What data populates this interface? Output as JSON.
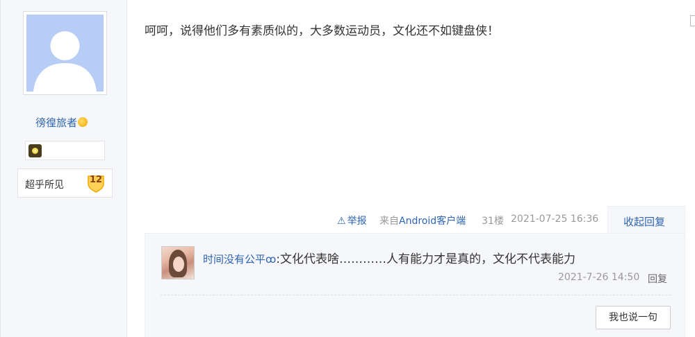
{
  "author": {
    "name": "徬徨旅者",
    "name_emoji": "laughing-emoji",
    "badge_icon": "medal-icon",
    "level_title": "超乎所见",
    "level_number": "12"
  },
  "post": {
    "content": "呵呵，说得他们多有素质似的，大多数运动员，文化还不如键盘侠！"
  },
  "meta": {
    "report_icon": "⚠",
    "report_label": "举报",
    "source_prefix": "来自",
    "source_name": "Android客户端",
    "floor": "31楼",
    "time": "2021-07-25 16:36",
    "collapse_label": "收起回复"
  },
  "reply": {
    "user": "时间没有公平",
    "user_suffix": "ꝏ",
    "separator": ":",
    "content": "文化代表啥…………人有能力才是真的，文化不代表能力",
    "time": "2021-7-26 14:50",
    "reply_label": "回复"
  },
  "say_button": "我也说一句",
  "colors": {
    "link": "#2d64b3",
    "muted": "#999999",
    "panel": "#f6f7fa",
    "avatar_bg": "#b7cdf6"
  }
}
